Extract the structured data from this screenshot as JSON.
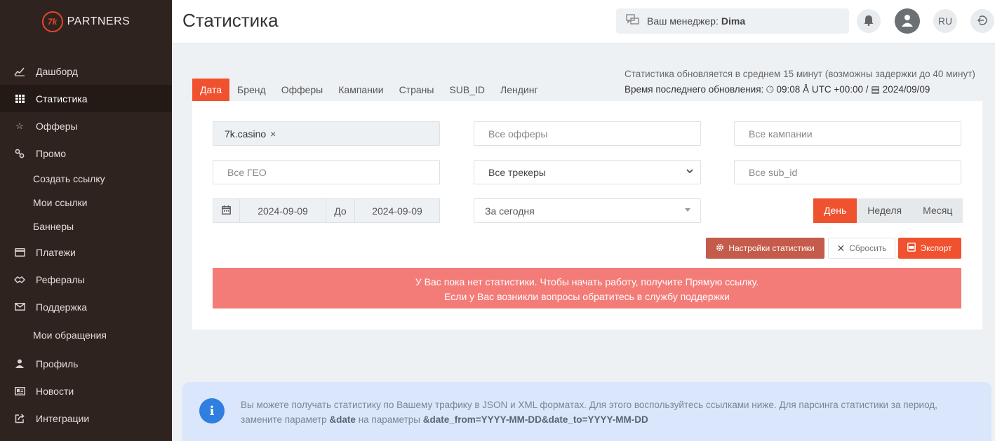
{
  "brand": {
    "logo_mark": "7k",
    "name": "PARTNERS"
  },
  "header": {
    "title": "Статистика",
    "manager_label": "Ваш менеджер:",
    "manager_name": "Dima",
    "lang": "RU"
  },
  "sidebar": {
    "items": [
      {
        "label": "Дашборд",
        "icon": "chart-line-icon"
      },
      {
        "label": "Статистика",
        "icon": "grid-table-icon",
        "active": true
      },
      {
        "label": "Офферы",
        "icon": "star-icon"
      },
      {
        "label": "Промо",
        "icon": "link-icon"
      },
      {
        "label": "Создать ссылку"
      },
      {
        "label": "Мои ссылки"
      },
      {
        "label": "Баннеры"
      },
      {
        "label": "Платежи",
        "icon": "credit-card-icon"
      },
      {
        "label": "Рефералы",
        "icon": "handshake-icon"
      },
      {
        "label": "Поддержка",
        "icon": "envelope-icon"
      },
      {
        "label": "Мои обращения"
      },
      {
        "label": "Профиль",
        "icon": "user-icon"
      },
      {
        "label": "Новости",
        "icon": "newspaper-icon"
      },
      {
        "label": "Интеграции",
        "icon": "share-icon"
      }
    ]
  },
  "update_info": {
    "line1": "Статистика обновляется в среднем 15 минут (возможны задержки до 40 минут)",
    "line2_label": "Время последнего обновления:",
    "time": "09:08",
    "tz": "UTC +00:00 /",
    "date": "2024/09/09"
  },
  "tabs": [
    "Дата",
    "Бренд",
    "Офферы",
    "Кампании",
    "Страны",
    "SUB_ID",
    "Лендинг"
  ],
  "filters": {
    "brand_tag": "7k.casino",
    "tag_remove": "×",
    "offers_placeholder": "Все офферы",
    "campaigns_placeholder": "Все кампании",
    "geo_placeholder": "Все ГЕО",
    "trackers_value": "Все трекеры",
    "subid_placeholder": "Все sub_id",
    "date_from": "2024-09-09",
    "date_to_label": "До",
    "date_to": "2024-09-09",
    "range_value": "За сегодня"
  },
  "period": [
    "День",
    "Неделя",
    "Месяц"
  ],
  "actions": {
    "settings": "Настройки статистики",
    "reset": "Сбросить",
    "export": "Экспорт"
  },
  "alert": {
    "line1": "У Вас пока нет статистики. Чтобы начать работу, получите Прямую ссылку.",
    "line2": "Если у Вас возникли вопросы обратитесь в службу поддержки"
  },
  "info": {
    "text1": "Вы можете получать статистику по Вашему трафику в JSON и XML форматах. Для этого воспользуйтесь ссылками ниже. Для парсинга статистики за период,",
    "text2a": "замените параметр",
    "param1": "&date",
    "text2b": "на параметры",
    "param2": "&date_from=YYYY-MM-DD&date_to=YYYY-MM-DD"
  },
  "colors": {
    "accent": "#f0512e",
    "sidebar": "#2f2320",
    "alert": "#f47c78",
    "info_bg": "#d9e6fb"
  }
}
